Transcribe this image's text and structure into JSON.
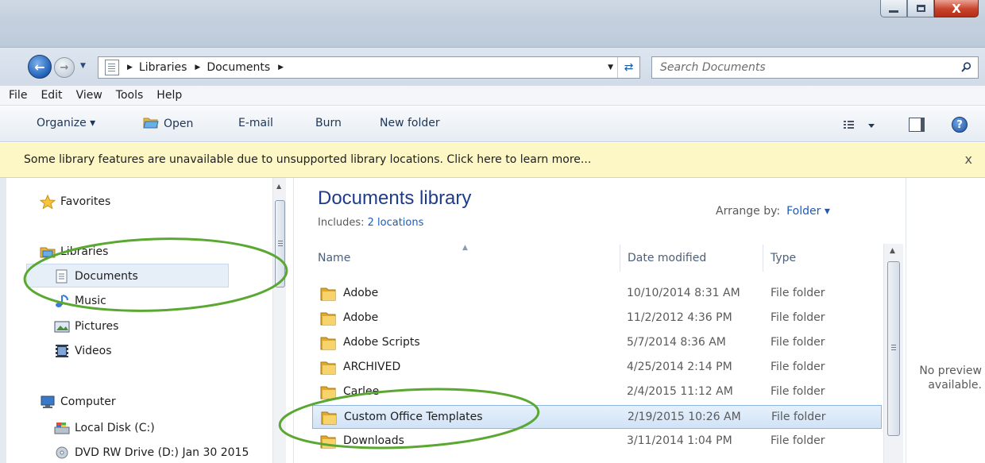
{
  "window": {
    "controls": {
      "minimize": "minimize",
      "maximize": "maximize",
      "close": "X"
    }
  },
  "nav": {
    "breadcrumb": [
      "Libraries",
      "Documents"
    ],
    "search_placeholder": "Search Documents"
  },
  "menu": [
    "File",
    "Edit",
    "View",
    "Tools",
    "Help"
  ],
  "toolbar": {
    "organize": "Organize ▾",
    "open": "Open",
    "email": "E-mail",
    "burn": "Burn",
    "new_folder": "New folder"
  },
  "infobar": {
    "message": "Some library features are unavailable due to unsupported library locations. Click here to learn more...",
    "close": "x"
  },
  "sidebar": {
    "favorites": "Favorites",
    "libraries": "Libraries",
    "library_items": [
      "Documents",
      "Music",
      "Pictures",
      "Videos"
    ],
    "computer": "Computer",
    "drives": [
      "Local Disk (C:)",
      "DVD RW Drive (D:) Jan 30 2015"
    ]
  },
  "library": {
    "title": "Documents library",
    "includes_label": "Includes:",
    "includes_link": "2 locations",
    "arrange_label": "Arrange by:",
    "arrange_value": "Folder ▾"
  },
  "columns": {
    "name": "Name",
    "date": "Date modified",
    "type": "Type"
  },
  "files": [
    {
      "name": "Adobe",
      "date": "10/10/2014 8:31 AM",
      "type": "File folder"
    },
    {
      "name": "Adobe",
      "date": "11/2/2012 4:36 PM",
      "type": "File folder"
    },
    {
      "name": "Adobe Scripts",
      "date": "5/7/2014 8:36 AM",
      "type": "File folder"
    },
    {
      "name": "ARCHIVED",
      "date": "4/25/2014 2:14 PM",
      "type": "File folder"
    },
    {
      "name": "Carlee",
      "date": "2/4/2015 11:12 AM",
      "type": "File folder"
    },
    {
      "name": "Custom Office Templates",
      "date": "2/19/2015 10:26 AM",
      "type": "File folder"
    },
    {
      "name": "Downloads",
      "date": "3/11/2014 1:04 PM",
      "type": "File folder"
    }
  ],
  "preview": {
    "line1": "No preview",
    "line2": "available."
  },
  "colors": {
    "annotation": "#5aa832",
    "title_blue": "#1e3c8a",
    "link_blue": "#1e5bb5",
    "infobar": "#fdf6c5"
  }
}
